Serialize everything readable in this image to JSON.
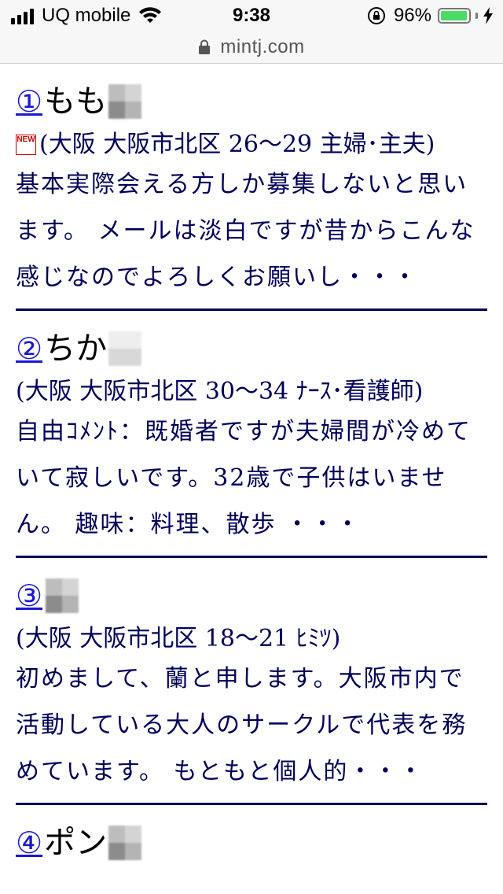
{
  "status_bar": {
    "carrier": "UQ mobile",
    "time": "9:38",
    "battery_percent": "96%",
    "battery_level": 0.96,
    "battery_color": "#4cd964"
  },
  "url_bar": {
    "url": "mintj.com"
  },
  "entries": [
    {
      "number": "①",
      "name": "もも",
      "is_new": true,
      "new_badge": "NEW",
      "meta": "(大阪 大阪市北区 26〜29 主婦･主夫)",
      "body": "基本実際会える方しか募集しないと思います。 メールは淡白ですが昔からこんな感じなのでよろしくお願いし・・・"
    },
    {
      "number": "②",
      "name": "ちか",
      "is_new": false,
      "meta": "(大阪 大阪市北区 30〜34 ﾅｰｽ･看護師)",
      "body": "自由ｺﾒﾝﾄ：既婚者ですが夫婦間が冷めていて寂しいです。32歳で子供はいません。 趣味：料理、散歩 ・・・"
    },
    {
      "number": "③",
      "name": "",
      "is_new": false,
      "meta": "(大阪 大阪市北区 18〜21 ﾋﾐﾂ)",
      "body": "初めまして、蘭と申します。大阪市内で活動している大人のサークルで代表を務めています。 もともと個人的・・・"
    },
    {
      "number": "④",
      "name": "ポン",
      "is_new": false,
      "meta": "",
      "body": ""
    }
  ],
  "colors": {
    "link": "#1a1ad0",
    "text": "#00005a",
    "divider": "#00005a"
  }
}
